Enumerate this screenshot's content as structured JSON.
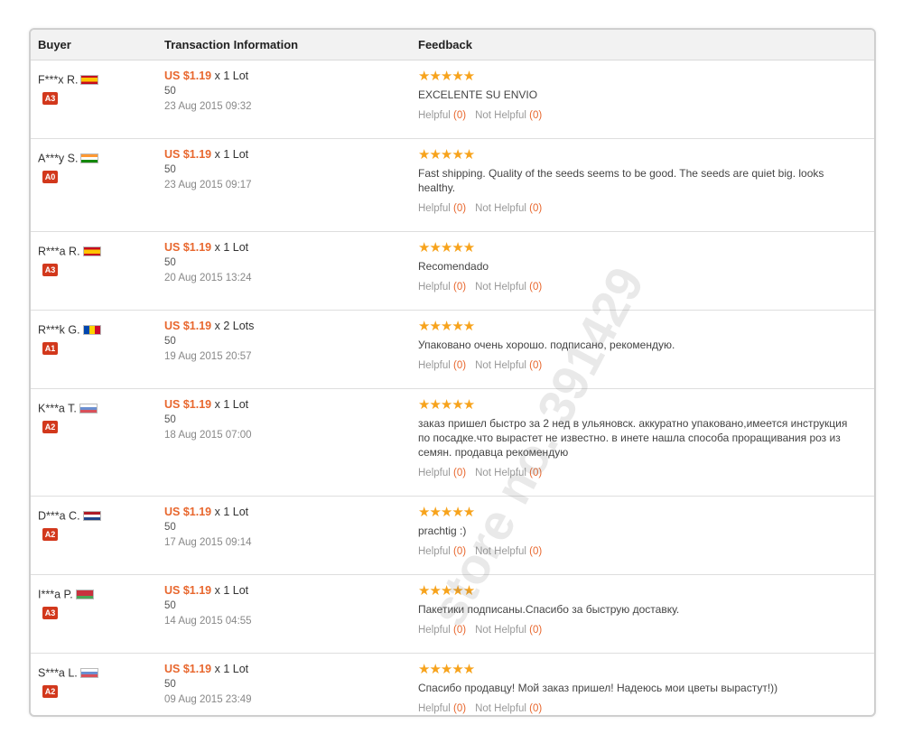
{
  "table": {
    "headers": {
      "buyer": "Buyer",
      "transaction": "Transaction Information",
      "feedback": "Feedback"
    },
    "rows": [
      {
        "buyer": "F***x R.",
        "flag": "es",
        "level": "A3",
        "price": "US $1.19",
        "qty": "x 1 Lot",
        "units": "50",
        "date": "23 Aug 2015 09:32",
        "stars": "★★★★★",
        "comment": "EXCELENTE SU ENVIO",
        "helpful_label": "Helpful",
        "helpful_count": "(0)",
        "not_helpful_label": "Not Helpful",
        "not_helpful_count": "(0)"
      },
      {
        "buyer": "A***y S.",
        "flag": "in",
        "level": "A0",
        "price": "US $1.19",
        "qty": "x 1 Lot",
        "units": "50",
        "date": "23 Aug 2015 09:17",
        "stars": "★★★★★",
        "comment": "Fast shipping. Quality of the seeds seems to be good. The seeds are quiet big. looks healthy.",
        "helpful_label": "Helpful",
        "helpful_count": "(0)",
        "not_helpful_label": "Not Helpful",
        "not_helpful_count": "(0)"
      },
      {
        "buyer": "R***a R.",
        "flag": "es",
        "level": "A3",
        "price": "US $1.19",
        "qty": "x 1 Lot",
        "units": "50",
        "date": "20 Aug 2015 13:24",
        "stars": "★★★★★",
        "comment": "Recomendado",
        "helpful_label": "Helpful",
        "helpful_count": "(0)",
        "not_helpful_label": "Not Helpful",
        "not_helpful_count": "(0)"
      },
      {
        "buyer": "R***k G.",
        "flag": "md",
        "level": "A1",
        "price": "US $1.19",
        "qty": "x 2 Lots",
        "units": "50",
        "date": "19 Aug 2015 20:57",
        "stars": "★★★★★",
        "comment": "Упаковано очень хорошо. подписано, рекомендую.",
        "helpful_label": "Helpful",
        "helpful_count": "(0)",
        "not_helpful_label": "Not Helpful",
        "not_helpful_count": "(0)"
      },
      {
        "buyer": "K***a T.",
        "flag": "ru",
        "level": "A2",
        "price": "US $1.19",
        "qty": "x 1 Lot",
        "units": "50",
        "date": "18 Aug 2015 07:00",
        "stars": "★★★★★",
        "comment": "заказ пришел быстро за 2 нед в ульяновск. аккуратно упаковано,имеется инструкция по посадке.что вырастет не известно. в инете нашла способа проращивания роз из семян. продавца рекомендую",
        "helpful_label": "Helpful",
        "helpful_count": "(0)",
        "not_helpful_label": "Not Helpful",
        "not_helpful_count": "(0)"
      },
      {
        "buyer": "D***a C.",
        "flag": "nl",
        "level": "A2",
        "price": "US $1.19",
        "qty": "x 1 Lot",
        "units": "50",
        "date": "17 Aug 2015 09:14",
        "stars": "★★★★★",
        "comment": "prachtig :)",
        "helpful_label": "Helpful",
        "helpful_count": "(0)",
        "not_helpful_label": "Not Helpful",
        "not_helpful_count": "(0)"
      },
      {
        "buyer": "I***a P.",
        "flag": "by",
        "level": "A3",
        "price": "US $1.19",
        "qty": "x 1 Lot",
        "units": "50",
        "date": "14 Aug 2015 04:55",
        "stars": "★★★★★",
        "comment": "Пакетики подписаны.Спасибо за быструю доставку.",
        "helpful_label": "Helpful",
        "helpful_count": "(0)",
        "not_helpful_label": "Not Helpful",
        "not_helpful_count": "(0)"
      },
      {
        "buyer": "S***a L.",
        "flag": "ru",
        "level": "A2",
        "price": "US $1.19",
        "qty": "x 1 Lot",
        "units": "50",
        "date": "09 Aug 2015 23:49",
        "stars": "★★★★★",
        "comment": "Спасибо продавцу! Мой заказ пришел! Надеюсь мои цветы вырастут!))",
        "helpful_label": "Helpful",
        "helpful_count": "(0)",
        "not_helpful_label": "Not Helpful",
        "not_helpful_count": "(0)"
      }
    ]
  },
  "watermark": "store no. 391429",
  "colors": {
    "price": "#e8672e",
    "stars": "#f7a31c",
    "badge": "#d2381c"
  }
}
